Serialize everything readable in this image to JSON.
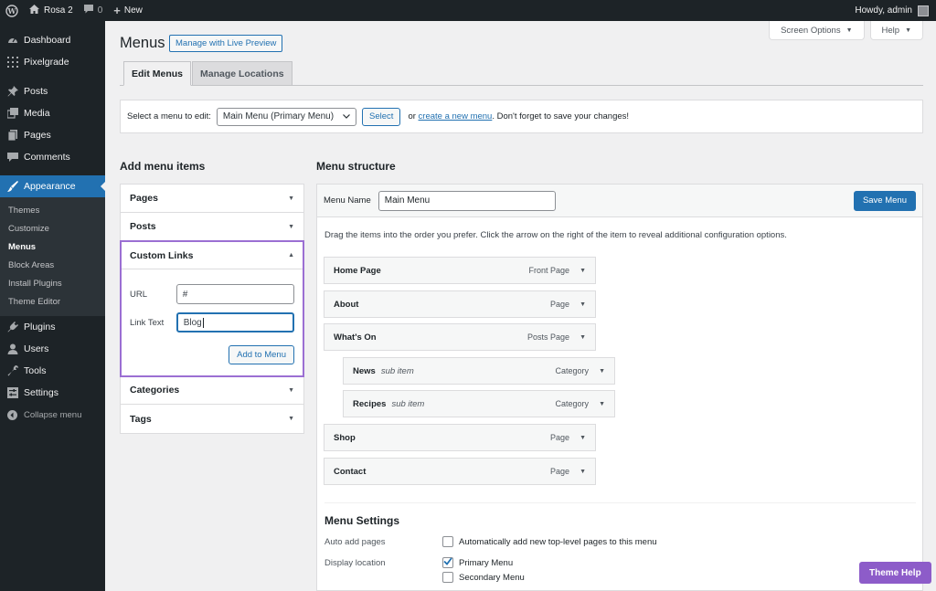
{
  "admin_bar": {
    "site_name": "Rosa 2",
    "comments_count": "0",
    "new_label": "New",
    "howdy": "Howdy, admin"
  },
  "sidebar": {
    "items": [
      {
        "label": "Dashboard",
        "icon": "dashboard-icon"
      },
      {
        "label": "Pixelgrade",
        "icon": "grid-icon"
      },
      {
        "label": "Posts",
        "icon": "pin-icon"
      },
      {
        "label": "Media",
        "icon": "media-icon"
      },
      {
        "label": "Pages",
        "icon": "page-icon"
      },
      {
        "label": "Comments",
        "icon": "comment-icon"
      },
      {
        "label": "Appearance",
        "icon": "brush-icon"
      }
    ],
    "submenu": [
      "Themes",
      "Customize",
      "Menus",
      "Block Areas",
      "Install Plugins",
      "Theme Editor"
    ],
    "items_after": [
      {
        "label": "Plugins",
        "icon": "plug-icon"
      },
      {
        "label": "Users",
        "icon": "user-icon"
      },
      {
        "label": "Tools",
        "icon": "wrench-icon"
      },
      {
        "label": "Settings",
        "icon": "settings-icon"
      }
    ],
    "collapse": "Collapse menu"
  },
  "screen_meta": {
    "screen_options": "Screen Options",
    "help": "Help"
  },
  "page": {
    "title": "Menus",
    "live_preview": "Manage with Live Preview",
    "tabs": [
      "Edit Menus",
      "Manage Locations"
    ]
  },
  "manage": {
    "label": "Select a menu to edit:",
    "selected_menu": "Main Menu (Primary Menu)",
    "select_button": "Select",
    "or": "or",
    "create_link": "create a new menu",
    "suffix": ". Don't forget to save your changes!"
  },
  "add_items": {
    "title": "Add menu items",
    "sections": [
      "Pages",
      "Posts"
    ],
    "custom_links": {
      "title": "Custom Links",
      "url_label": "URL",
      "url_value": "#",
      "text_label": "Link Text",
      "text_value": "Blog",
      "button": "Add to Menu"
    },
    "sections_after": [
      "Categories",
      "Tags"
    ]
  },
  "structure": {
    "title": "Menu structure",
    "menu_name_label": "Menu Name",
    "menu_name_value": "Main Menu",
    "save_button": "Save Menu",
    "instructions": "Drag the items into the order you prefer. Click the arrow on the right of the item to reveal additional configuration options.",
    "items": [
      {
        "title": "Home Page",
        "sub": "",
        "type": "Front Page",
        "depth": 0
      },
      {
        "title": "About",
        "sub": "",
        "type": "Page",
        "depth": 0
      },
      {
        "title": "What's On",
        "sub": "",
        "type": "Posts Page",
        "depth": 0
      },
      {
        "title": "News",
        "sub": "sub item",
        "type": "Category",
        "depth": 1
      },
      {
        "title": "Recipes",
        "sub": "sub item",
        "type": "Category",
        "depth": 1
      },
      {
        "title": "Shop",
        "sub": "",
        "type": "Page",
        "depth": 0
      },
      {
        "title": "Contact",
        "sub": "",
        "type": "Page",
        "depth": 0
      }
    ]
  },
  "settings": {
    "title": "Menu Settings",
    "auto_add_label": "Auto add pages",
    "auto_add_text": "Automatically add new top-level pages to this menu",
    "auto_add_checked": false,
    "display_location_label": "Display location",
    "locations": [
      {
        "label": "Primary Menu",
        "checked": true
      },
      {
        "label": "Secondary Menu",
        "checked": false
      }
    ]
  },
  "theme_help": "Theme Help",
  "colors": {
    "accent": "#2271b1",
    "admin_dark": "#1d2327",
    "theme_help": "#8d5cc9",
    "focus_outline": "#9b6fd3"
  }
}
